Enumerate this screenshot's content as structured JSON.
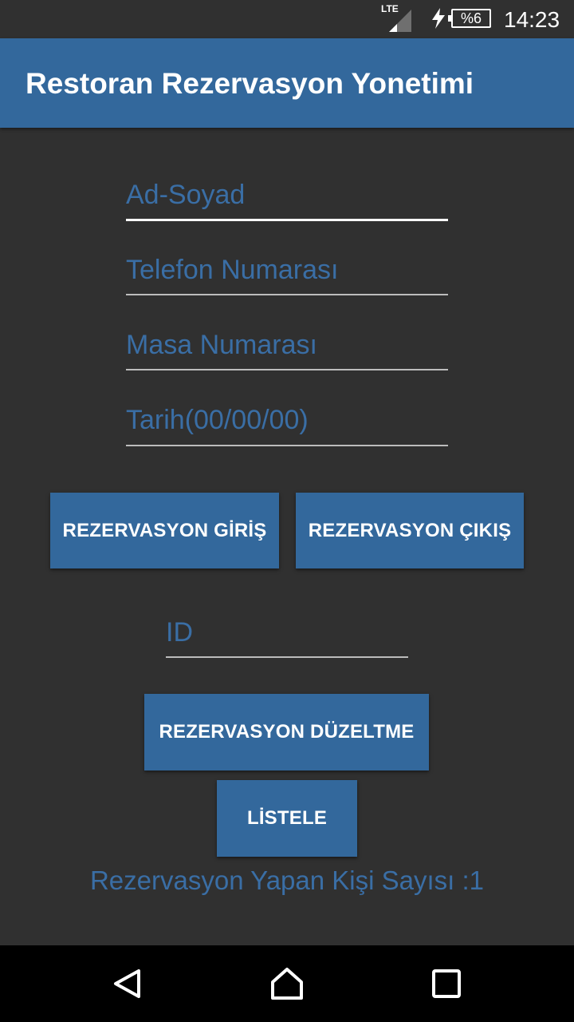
{
  "status_bar": {
    "network": "LTE",
    "battery": "%6",
    "time": "14:23"
  },
  "app_bar": {
    "title": "Restoran Rezervasyon Yonetimi"
  },
  "form": {
    "name_placeholder": "Ad-Soyad",
    "phone_placeholder": "Telefon Numarası",
    "table_placeholder": "Masa Numarası",
    "date_placeholder": "Tarih(00/00/00)",
    "checkin_label": "REZERVASYON GİRİŞ",
    "checkout_label": "REZERVASYON ÇIKIŞ",
    "id_placeholder": "ID",
    "edit_label": "REZERVASYON DÜZELTME",
    "list_label": "LİSTELE",
    "count_text": "Rezervasyon Yapan Kişi Sayısı :1"
  },
  "icons": {
    "signal": "signal-icon",
    "charging": "charging-bolt-icon",
    "battery": "battery-icon",
    "back": "back-triangle-icon",
    "home": "home-icon",
    "recents": "recents-square-icon"
  },
  "colors": {
    "primary": "#33689c",
    "background": "#303030",
    "hint_text": "#3a6ea5"
  }
}
